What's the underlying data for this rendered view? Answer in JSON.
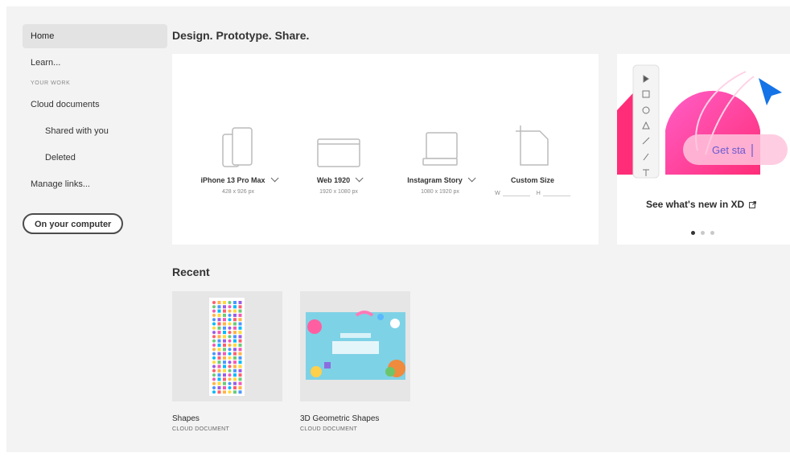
{
  "sidebar": {
    "items": [
      {
        "label": "Home"
      },
      {
        "label": "Learn..."
      }
    ],
    "section_label": "YOUR WORK",
    "work_items": [
      {
        "label": "Cloud documents"
      },
      {
        "label": "Shared with you"
      },
      {
        "label": "Deleted"
      }
    ],
    "manage_links": "Manage links...",
    "computer_button": "On your computer"
  },
  "main": {
    "heading": "Design. Prototype. Share.",
    "presets": [
      {
        "name": "iPhone 13 Pro Max",
        "dims": "428 x 926 px",
        "icon": "phone-icon"
      },
      {
        "name": "Web 1920",
        "dims": "1920 x 1080 px",
        "icon": "browser-icon"
      },
      {
        "name": "Instagram Story",
        "dims": "1080 x 1920 px",
        "icon": "instagram-icon"
      },
      {
        "name": "Custom Size",
        "icon": "custom-size-icon",
        "w_label": "W",
        "h_label": "H"
      }
    ],
    "promo": {
      "title": "See what's new in XD",
      "art_text": "Get sta",
      "slide_index": 1,
      "slide_count": 3
    },
    "recent_heading": "Recent",
    "recent": [
      {
        "name": "Shapes",
        "type": "CLOUD DOCUMENT"
      },
      {
        "name": "3D Geometric Shapes",
        "type": "CLOUD DOCUMENT"
      }
    ]
  },
  "colors": {
    "background": "#f3f3f3",
    "accent_pink": "#ff3aa0",
    "accent_blue": "#1473e6"
  }
}
